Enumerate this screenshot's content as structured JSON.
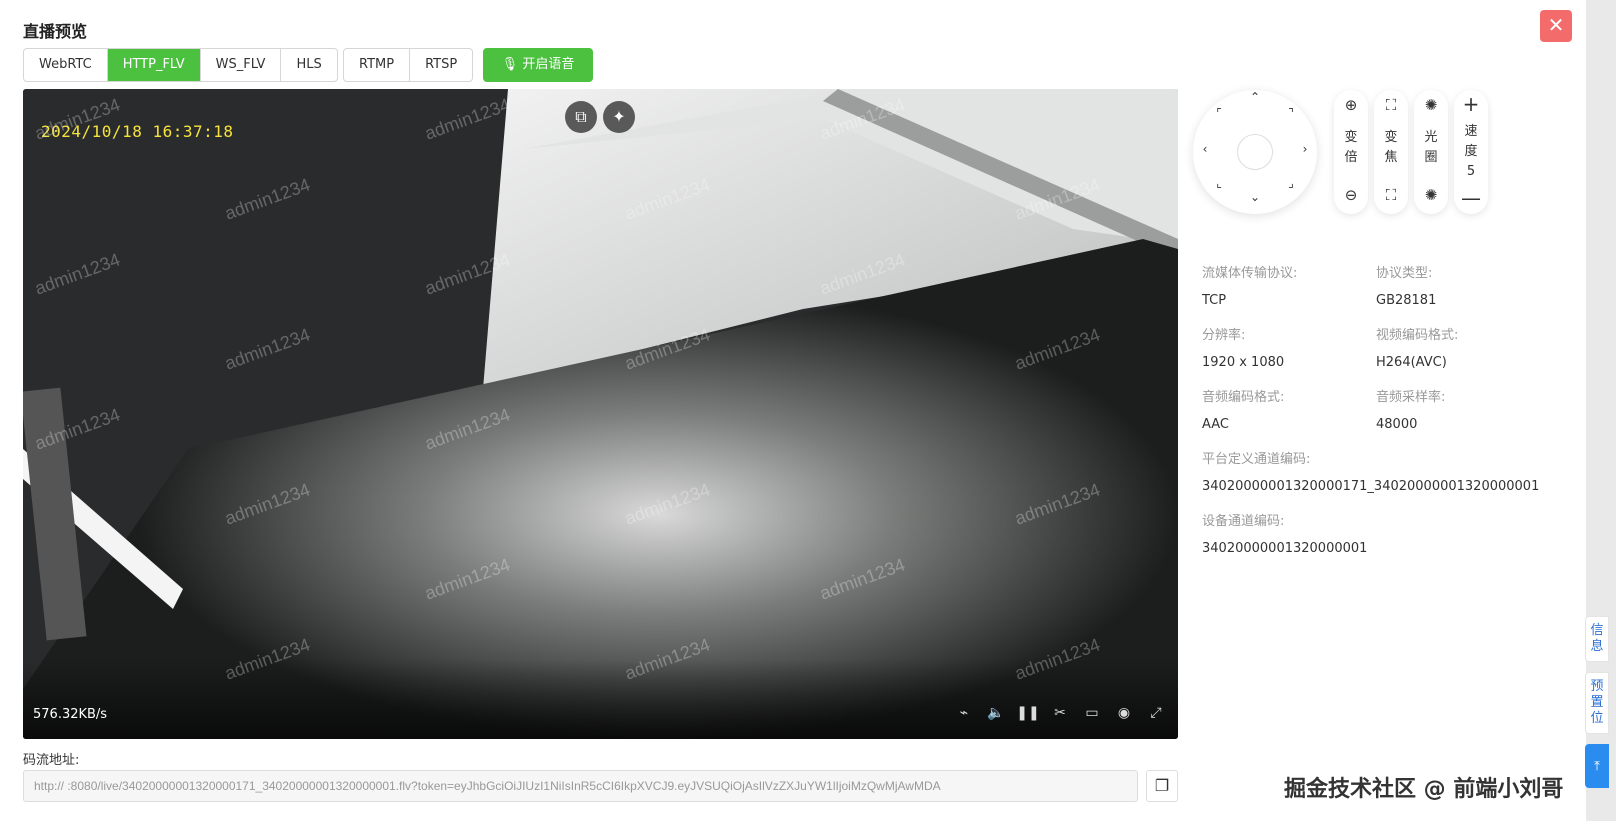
{
  "dialog": {
    "title": "直播预览",
    "close_icon": "close-icon"
  },
  "protocols": {
    "group1": [
      {
        "label": "WebRTC",
        "active": false
      },
      {
        "label": "HTTP_FLV",
        "active": true
      },
      {
        "label": "WS_FLV",
        "active": false
      },
      {
        "label": "HLS",
        "active": false
      }
    ],
    "group2": [
      {
        "label": "RTMP",
        "active": false
      },
      {
        "label": "RTSP",
        "active": false
      }
    ],
    "voice_label": "开启语音",
    "accent": "#4cc13f"
  },
  "video": {
    "osd_time": "2024/10/18  16:37:18",
    "watermark": "admin1234",
    "bitrate": "576.32KB/s"
  },
  "ptz": {
    "zoom_label": [
      "变",
      "倍"
    ],
    "focus_label": [
      "变",
      "焦"
    ],
    "iris_label": [
      "光",
      "圈"
    ],
    "speed_label": [
      "速",
      "度"
    ],
    "speed_value": "5"
  },
  "info": {
    "transport_key": "流媒体传输协议:",
    "transport_val": "TCP",
    "proto_type_key": "协议类型:",
    "proto_type_val": "GB28181",
    "resolution_key": "分辨率:",
    "resolution_val": "1920 x 1080",
    "vcodec_key": "视频编码格式:",
    "vcodec_val": "H264(AVC)",
    "acodec_key": "音频编码格式:",
    "acodec_val": "AAC",
    "samplerate_key": "音频采样率:",
    "samplerate_val": "48000",
    "platform_channel_key": "平台定义通道编码:",
    "platform_channel_val": "34020000001320000171_34020000001320000001",
    "device_channel_key": "设备通道编码:",
    "device_channel_val": "34020000001320000001"
  },
  "stream": {
    "label": "码流地址:",
    "url": "http://               :8080/live/34020000001320000171_34020000001320000001.flv?token=eyJhbGciOiJIUzI1NiIsInR5cCI6IkpXVCJ9.eyJVSUQiOjAsIlVzZXJuYW1lIjoiMzQwMjAwMDA"
  },
  "side_tabs": {
    "info": "信息",
    "preset": "预置位"
  },
  "brand_watermark": "掘金技术社区 @ 前端小刘哥"
}
